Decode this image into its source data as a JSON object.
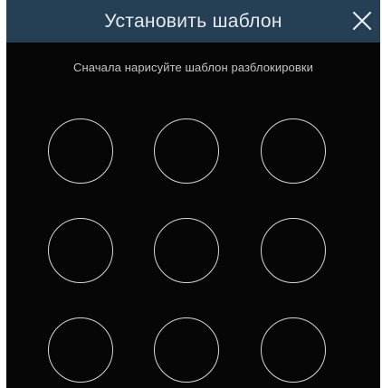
{
  "dialog": {
    "title": "Установить шаблон",
    "close_icon": "close-icon",
    "instruction": "Сначала нарисуйте шаблон разблокировки"
  },
  "pattern": {
    "rows": 3,
    "columns": 3,
    "selected_points": 0
  },
  "colors": {
    "titlebar": "#253f54",
    "background": "#060606",
    "circle_stroke": "#d8d8d8",
    "title_text": "#e6eaee"
  }
}
